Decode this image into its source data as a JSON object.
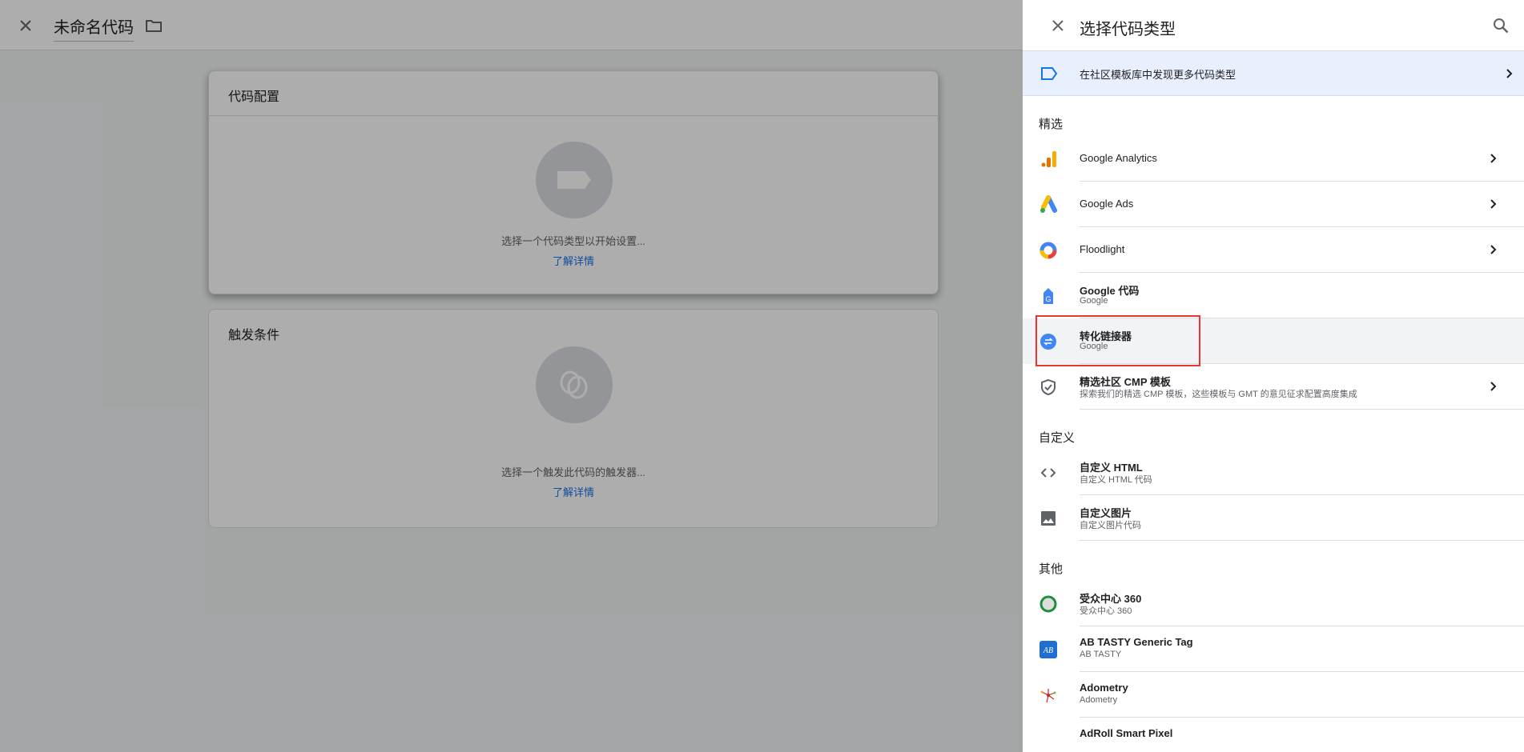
{
  "editor": {
    "title": "未命名代码",
    "config_card": {
      "title": "代码配置",
      "message": "选择一个代码类型以开始设置...",
      "link": "了解详情"
    },
    "trigger_card": {
      "title": "触发条件",
      "message": "选择一个触发此代码的触发器...",
      "link": "了解详情"
    }
  },
  "panel": {
    "title": "选择代码类型",
    "banner": "在社区模板库中发现更多代码类型",
    "sections": {
      "featured": "精选",
      "custom": "自定义",
      "other": "其他"
    },
    "featured": [
      {
        "label": "Google Analytics"
      },
      {
        "label": "Google Ads"
      },
      {
        "label": "Floodlight"
      },
      {
        "label": "Google 代码",
        "sub": "Google"
      },
      {
        "label": "转化链接器",
        "sub": "Google"
      },
      {
        "label": "精选社区 CMP 模板",
        "sub": "探索我们的精选 CMP 模板，这些模板与 GMT 的意见征求配置高度集成"
      }
    ],
    "custom": [
      {
        "label": "自定义 HTML",
        "sub": "自定义 HTML 代码"
      },
      {
        "label": "自定义图片",
        "sub": "自定义图片代码"
      }
    ],
    "other": [
      {
        "label": "受众中心 360",
        "sub": "受众中心 360"
      },
      {
        "label": "AB TASTY Generic Tag",
        "sub": "AB TASTY"
      },
      {
        "label": "Adometry",
        "sub": "Adometry"
      },
      {
        "label": "AdRoll Smart Pixel",
        "sub": ""
      }
    ]
  },
  "colors": {
    "accent": "#1a73e8",
    "highlight": "#ea3535",
    "banner_bg": "#e8f0fe"
  }
}
